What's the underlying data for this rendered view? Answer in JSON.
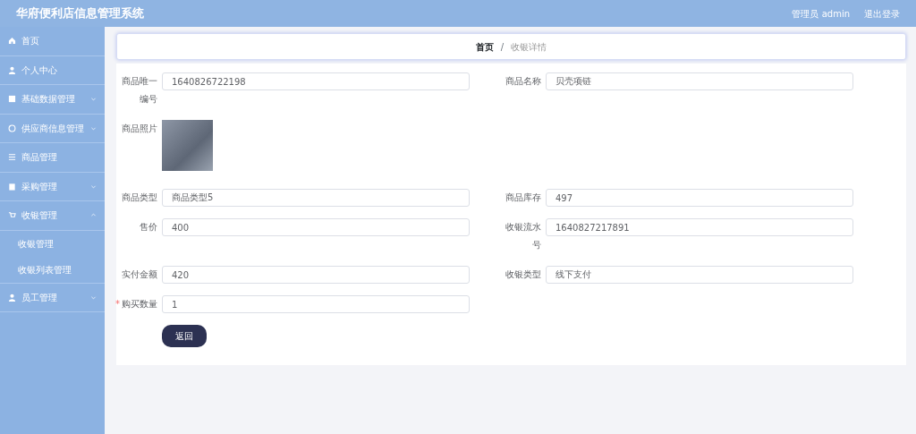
{
  "header": {
    "title": "华府便利店信息管理系统",
    "user": "管理员 admin",
    "logout": "退出登录"
  },
  "sidebar": {
    "items": [
      {
        "label": "首页",
        "expandable": false
      },
      {
        "label": "个人中心",
        "expandable": false
      },
      {
        "label": "基础数据管理",
        "expandable": true,
        "expanded": false
      },
      {
        "label": "供应商信息管理",
        "expandable": true,
        "expanded": false
      },
      {
        "label": "商品管理",
        "expandable": false
      },
      {
        "label": "采购管理",
        "expandable": true,
        "expanded": false
      },
      {
        "label": "收银管理",
        "expandable": true,
        "expanded": true,
        "children": [
          {
            "label": "收银管理"
          },
          {
            "label": "收银列表管理"
          }
        ]
      },
      {
        "label": "员工管理",
        "expandable": true,
        "expanded": false
      }
    ]
  },
  "breadcrumb": {
    "separator": "/",
    "items": [
      {
        "label": "首页",
        "current": false
      },
      {
        "label": "收银详情",
        "current": true
      }
    ]
  },
  "form": {
    "rows": [
      {
        "fields": [
          {
            "kind": "text",
            "label": "商品唯一编号",
            "value": "1640826722198",
            "required": false
          },
          {
            "kind": "text",
            "label": "商品名称",
            "value": "贝壳项链",
            "required": false
          }
        ]
      },
      {
        "fields": [
          {
            "kind": "image",
            "label": "商品照片",
            "required": false
          }
        ]
      },
      {
        "fields": [
          {
            "kind": "text",
            "label": "商品类型",
            "value": "商品类型5",
            "required": false
          },
          {
            "kind": "text",
            "label": "商品库存",
            "value": "497",
            "required": false
          }
        ]
      },
      {
        "fields": [
          {
            "kind": "text",
            "label": "售价",
            "value": "400",
            "required": false
          },
          {
            "kind": "text",
            "label": "收银流水号",
            "value": "1640827217891",
            "required": false
          }
        ]
      },
      {
        "fields": [
          {
            "kind": "text",
            "label": "实付金额",
            "value": "420",
            "required": false
          },
          {
            "kind": "text",
            "label": "收银类型",
            "value": "线下支付",
            "required": false
          }
        ]
      },
      {
        "fields": [
          {
            "kind": "text",
            "label": "购买数量",
            "value": "1",
            "required": true
          }
        ]
      }
    ],
    "required_mark": "*",
    "back_button": "返回"
  }
}
